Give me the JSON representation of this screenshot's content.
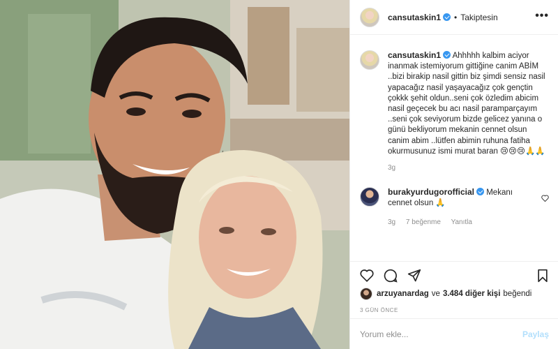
{
  "post": {
    "username": "cansutaskin1",
    "dot": "•",
    "follow_status": "Takiptesin",
    "more": "•••"
  },
  "caption": {
    "username": "cansutaskin1",
    "text": "Ahhhhh kalbim aciyor inanmak istemiyorum gittiğine canim ABİM ..bizi birakip nasil gittin biz şimdi sensiz nasil yapacağız nasil yaşayacağız çok gençtin çokkk şehit oldun..seni çok özledim abicim nasil geçecek bu acı nasil paramparçayım ..seni çok seviyorum bizde gelicez yanına o günü bekliyorum mekanin cennet olsun canim abim ..lütfen abimin ruhuna fatiha okurmusunuz ismi murat baran 😢😢😢🙏🙏",
    "age": "3g"
  },
  "reply": {
    "username": "burakyurdugorofficial",
    "text": "Mekanı cennet olsun 🙏",
    "age": "3g",
    "likes": "7 beğenme",
    "reply_label": "Yanıtla"
  },
  "likes": {
    "liker": "arzuyanardag",
    "connector": "ve",
    "others": "3.484 diğer kişi",
    "suffix": "beğendi"
  },
  "date": "3 GÜN ÖNCE",
  "comment_box": {
    "placeholder": "Yorum ekle...",
    "share_label": "Paylaş"
  },
  "colors": {
    "verified": "#3897f0",
    "share_disabled": "#b2dffc",
    "muted": "#8e8e8e",
    "text": "#262626"
  },
  "icons": [
    "verified-icon",
    "more-icon",
    "heart-icon",
    "comment-icon",
    "share-icon",
    "bookmark-icon",
    "small-heart-icon"
  ]
}
